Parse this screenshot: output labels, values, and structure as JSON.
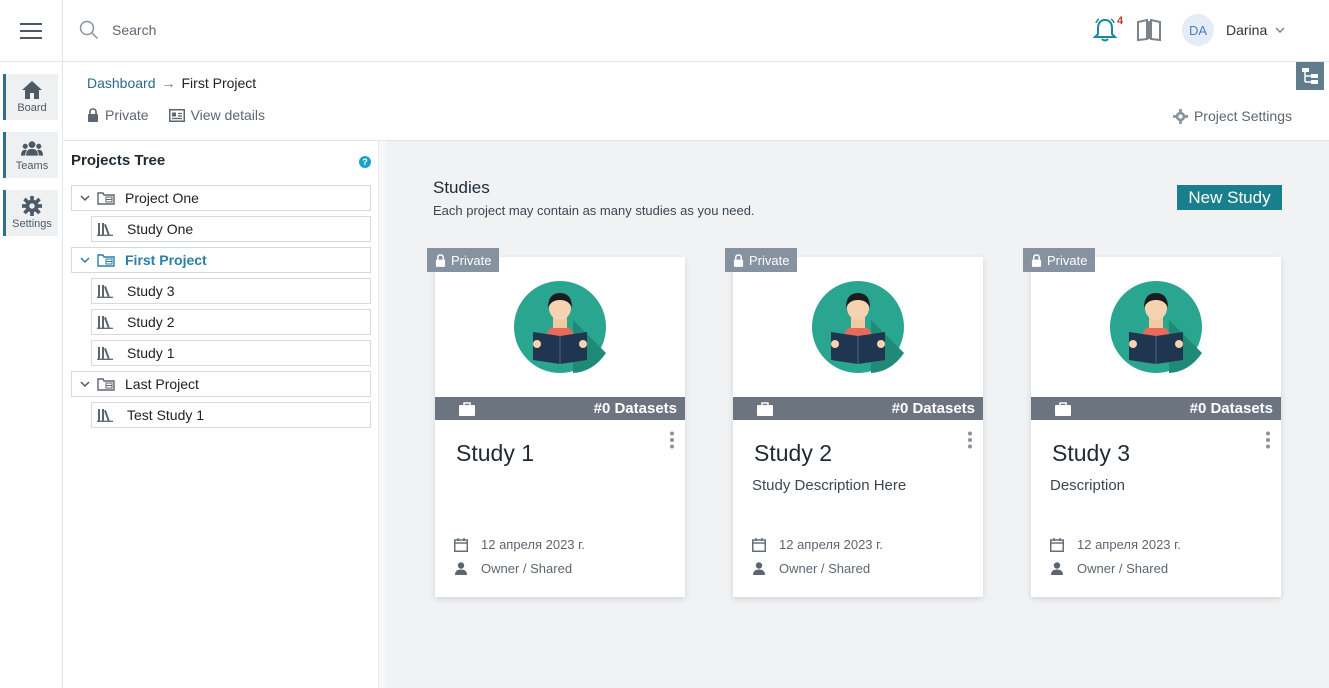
{
  "header": {
    "search_placeholder": "Search",
    "notification_count": "4",
    "user": {
      "initials": "DA",
      "name": "Darina"
    }
  },
  "rail": {
    "items": [
      {
        "label": "Board",
        "icon": "home-icon"
      },
      {
        "label": "Teams",
        "icon": "users-icon"
      },
      {
        "label": "Settings",
        "icon": "gear-icon"
      }
    ]
  },
  "breadcrumb": {
    "root": "Dashboard",
    "current": "First Project"
  },
  "project_meta": {
    "privacy": "Private",
    "view_details": "View details",
    "settings": "Project Settings"
  },
  "tree": {
    "title": "Projects Tree",
    "help": "?",
    "nodes": [
      {
        "label": "Project One",
        "type": "project"
      },
      {
        "label": "Study One",
        "type": "study"
      },
      {
        "label": "First Project",
        "type": "project",
        "active": true
      },
      {
        "label": "Study 3",
        "type": "study"
      },
      {
        "label": "Study 2",
        "type": "study"
      },
      {
        "label": "Study 1",
        "type": "study"
      },
      {
        "label": "Last Project",
        "type": "project"
      },
      {
        "label": "Test Study 1",
        "type": "study"
      }
    ]
  },
  "studies": {
    "title": "Studies",
    "subtitle": "Each project may contain as many studies as you need.",
    "new_button": "New Study",
    "cards": [
      {
        "badge": "Private",
        "datasets": "#0 Datasets",
        "title": "Study 1",
        "description": "",
        "date": "12 апреля 2023 г.",
        "owner": "Owner / Shared"
      },
      {
        "badge": "Private",
        "datasets": "#0 Datasets",
        "title": "Study 2",
        "description": "Study Description Here",
        "date": "12 апреля 2023 г.",
        "owner": "Owner / Shared"
      },
      {
        "badge": "Private",
        "datasets": "#0 Datasets",
        "title": "Study 3",
        "description": "Description",
        "date": "12 апреля 2023 г.",
        "owner": "Owner / Shared"
      }
    ]
  },
  "colors": {
    "accent": "#1a7f8c",
    "link": "#2a6a8a",
    "badge": "#8792a0",
    "bar": "#6c7480"
  }
}
